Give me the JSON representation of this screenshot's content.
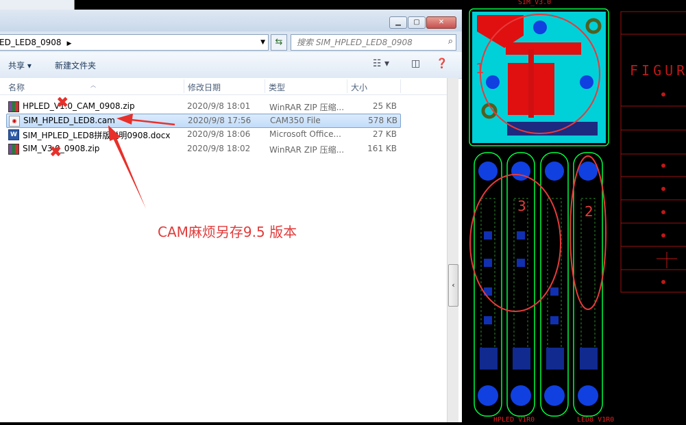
{
  "explorer": {
    "breadcrumb": "ED_LED8_0908",
    "search_placeholder": "搜索 SIM_HPLED_LED8_0908",
    "toolbar": {
      "share": "共享",
      "new_folder": "新建文件夹"
    },
    "columns": {
      "name": "名称",
      "date": "修改日期",
      "type": "类型",
      "size": "大小"
    },
    "files": [
      {
        "name": "HPLED_V1.0_CAM_0908.zip",
        "date": "2020/9/8 18:01",
        "type": "WinRAR ZIP 压缩...",
        "size": "25 KB",
        "icon": "zip-icon",
        "selected": false
      },
      {
        "name": "SIM_HPLED_LED8.cam",
        "date": "2020/9/8 17:56",
        "type": "CAM350 File",
        "size": "578 KB",
        "icon": "cam-file-icon",
        "selected": true
      },
      {
        "name": "SIM_HPLED_LED8拼版说明0908.docx",
        "date": "2020/9/8 18:06",
        "type": "Microsoft Office...",
        "size": "27 KB",
        "icon": "word-doc-icon",
        "selected": false
      },
      {
        "name": "SIM_V3.0_0908.zip",
        "date": "2020/9/8 18:02",
        "type": "WinRAR ZIP 压缩...",
        "size": "161 KB",
        "icon": "zip-icon",
        "selected": false
      }
    ]
  },
  "annotation": {
    "text": "CAM麻烦另存9.5 版本",
    "color": "#e23a3a"
  },
  "pcb": {
    "top_label": "SIM_V3.0",
    "bottom_labels": [
      "HPLED_V1R0",
      "LED8_V1R0"
    ],
    "right_label": "FIGUR",
    "region_numbers": [
      "1",
      "2",
      "3"
    ],
    "board_color": "#00d0d8",
    "outline_color": "#00ff40",
    "copper_color": "#ff0000"
  }
}
